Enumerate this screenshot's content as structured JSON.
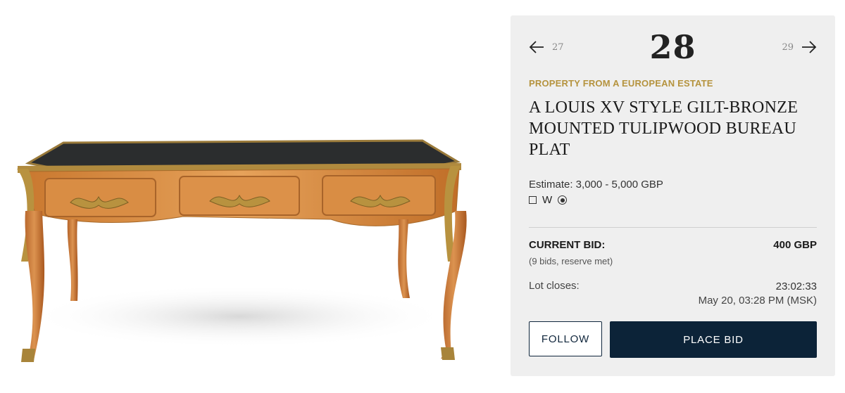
{
  "lot": {
    "number": "28",
    "prev_number": "27",
    "next_number": "29",
    "provenance": "PROPERTY FROM A EUROPEAN ESTATE",
    "title": "A LOUIS XV STYLE GILT-BRONZE MOUNTED TULIPWOOD BUREAU PLAT",
    "estimate": "Estimate: 3,000 - 5,000 GBP",
    "icon_w_label": "W"
  },
  "bidding": {
    "current_bid_label": "CURRENT BID:",
    "current_bid_value": "400 GBP",
    "bids_info": "(9 bids, reserve met)",
    "lot_closes_label": "Lot closes:",
    "countdown": "23:02:33",
    "close_date": "May 20, 03:28 PM (MSK)"
  },
  "buttons": {
    "follow": "FOLLOW",
    "place_bid": "PLACE BID"
  },
  "colors": {
    "accent_gold": "#b5933e",
    "navy": "#0c2338",
    "panel_bg": "#efefef"
  },
  "icons": [
    "arrow-left-icon",
    "arrow-right-icon",
    "checkbox-icon",
    "radio-icon"
  ]
}
